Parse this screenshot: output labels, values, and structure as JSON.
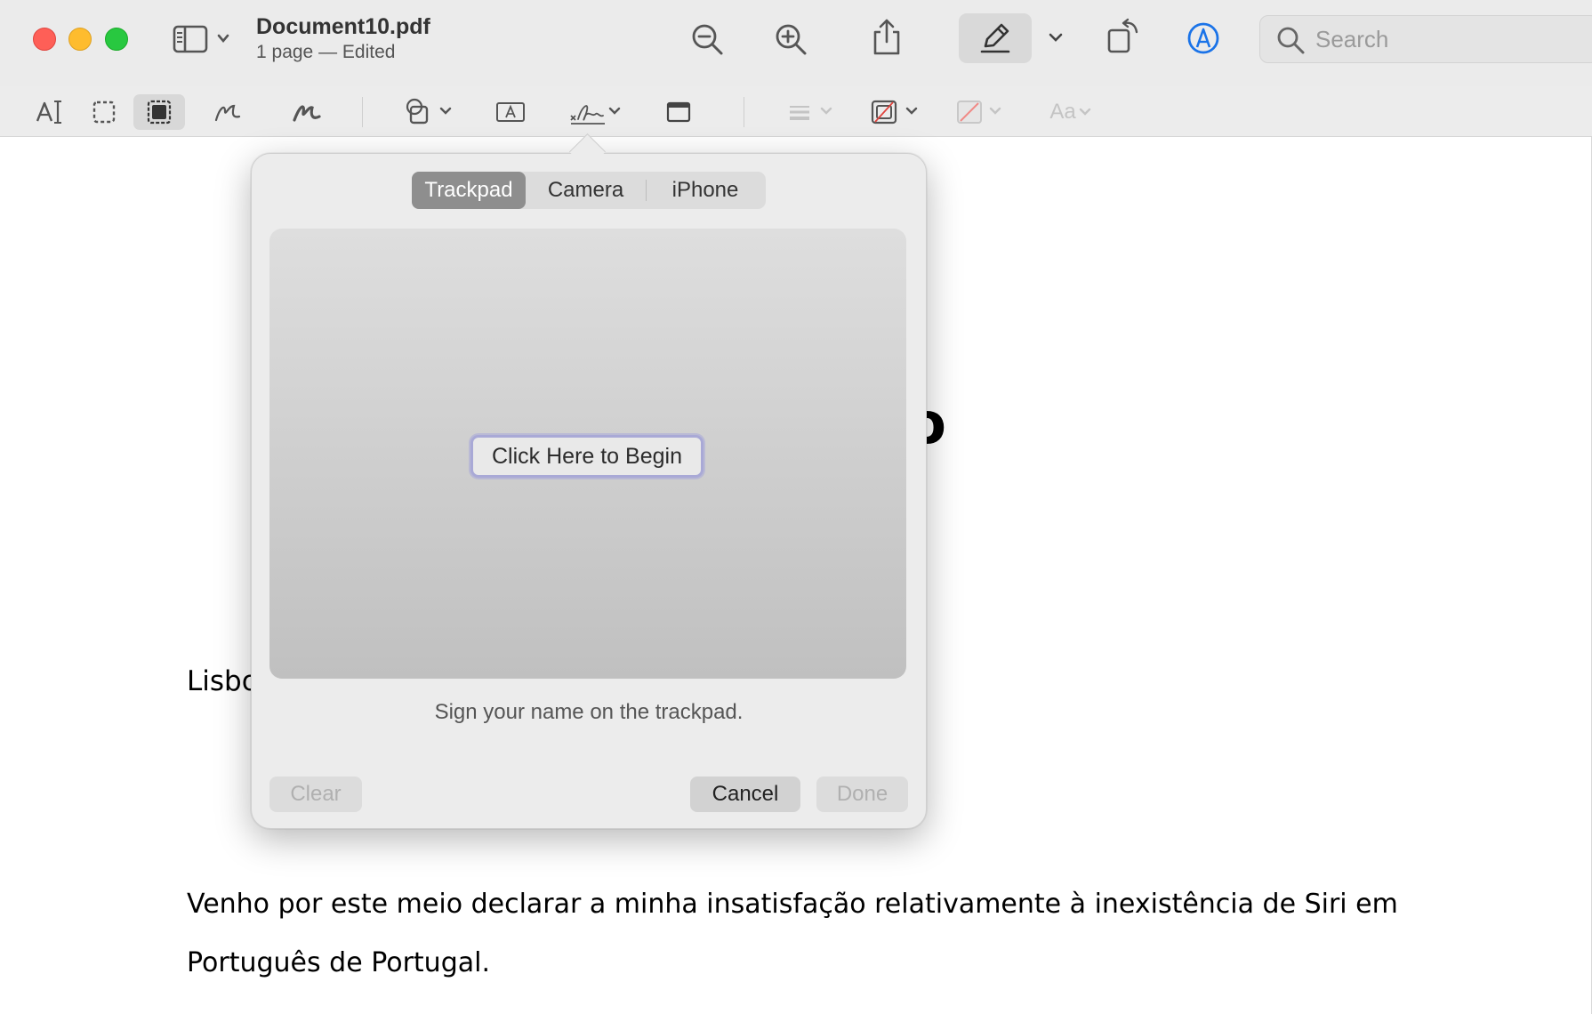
{
  "window": {
    "title": "Document10.pdf",
    "subtitle": "1 page — Edited"
  },
  "toolbar": {
    "icons": [
      "sidebar-icon",
      "zoom-out-icon",
      "zoom-in-icon",
      "share-icon",
      "markup-pen-icon",
      "rotate-icon",
      "annotate-icon"
    ],
    "search_placeholder": "Search"
  },
  "markup_toolbar": {
    "tools": [
      "text-selection-icon",
      "rectangular-selection-icon",
      "smart-lasso-icon",
      "sketch-icon",
      "draw-icon",
      "shapes-icon",
      "text-box-icon",
      "sign-icon",
      "note-icon",
      "line-style-icon",
      "border-color-icon",
      "fill-color-icon",
      "font-style-icon"
    ],
    "font_label": "Aa"
  },
  "document": {
    "partial_heading": "o",
    "partial_text": "Lisbo",
    "paragraph_line1": "Venho por este meio declarar a minha insatisfação relativamente à inexistência de Siri em",
    "paragraph_line2": "Português de Portugal."
  },
  "signature_popover": {
    "tabs": [
      "Trackpad",
      "Camera",
      "iPhone"
    ],
    "selected_tab": "Trackpad",
    "begin_label": "Click Here to Begin",
    "hint": "Sign your name on the trackpad.",
    "clear_label": "Clear",
    "cancel_label": "Cancel",
    "done_label": "Done"
  },
  "colors": {
    "close": "#fe5f57",
    "minimize": "#febc2e",
    "zoom": "#28c840",
    "accent_blue": "#1a73e8"
  }
}
